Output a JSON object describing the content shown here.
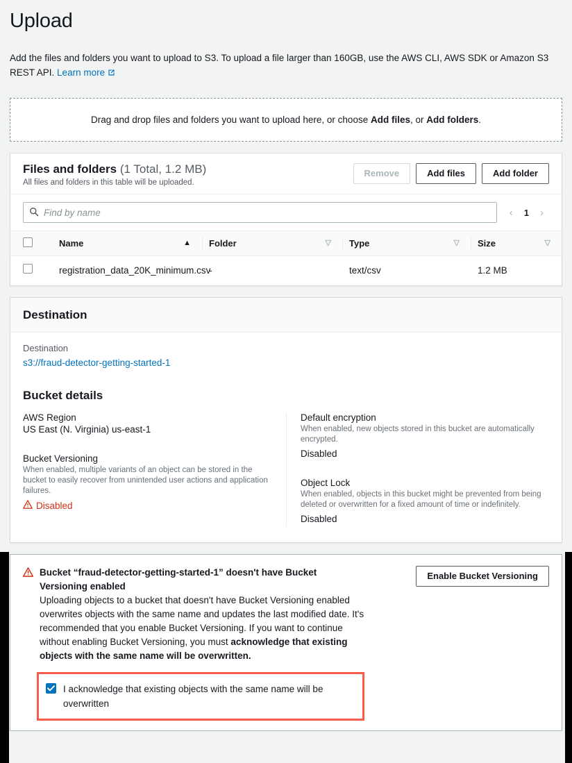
{
  "header": {
    "title": "Upload",
    "description_part1": "Add the files and folders you want to upload to S3. To upload a file larger than 160GB, use the AWS CLI, AWS SDK or Amazon S3 REST API.",
    "learn_more": "Learn more",
    "external_link_icon": "external-link-icon"
  },
  "dropzone": {
    "text_before": "Drag and drop files and folders you want to upload here, or choose ",
    "add_files_bold": "Add files",
    "text_middle": ", or ",
    "add_folders_bold": "Add folders",
    "text_after": "."
  },
  "files_panel": {
    "title": "Files and folders",
    "count": "(1 Total, 1.2 MB)",
    "subtitle": "All files and folders in this table will be uploaded.",
    "buttons": {
      "remove": "Remove",
      "add_files": "Add files",
      "add_folder": "Add folder"
    },
    "search": {
      "placeholder": "Find by name",
      "value": "",
      "icon": "search-icon"
    },
    "pagination": {
      "prev": "‹",
      "page": "1",
      "next": "›"
    },
    "columns": [
      {
        "label": "Name",
        "sort": "asc"
      },
      {
        "label": "Folder",
        "sort": "none"
      },
      {
        "label": "Type",
        "sort": "none"
      },
      {
        "label": "Size",
        "sort": "none"
      }
    ],
    "rows": [
      {
        "name": "registration_data_20K_minimum.csv",
        "folder": "-",
        "type": "text/csv",
        "size": "1.2 MB",
        "selected": false
      }
    ]
  },
  "destination": {
    "section_title": "Destination",
    "label": "Destination",
    "path": "s3://fraud-detector-getting-started-1",
    "bucket_details_title": "Bucket details",
    "fields": [
      {
        "title": "AWS Region",
        "desc": "",
        "value": "US East (N. Virginia) us-east-1",
        "warn": false
      },
      {
        "title": "Default encryption",
        "desc": "When enabled, new objects stored in this bucket are automatically encrypted.",
        "value": "Disabled",
        "warn": false
      },
      {
        "title": "Bucket Versioning",
        "desc": "When enabled, multiple variants of an object can be stored in the bucket to easily recover from unintended user actions and application failures.",
        "value": "Disabled",
        "warn": true
      },
      {
        "title": "Object Lock",
        "desc": "When enabled, objects in this bucket might be prevented from being deleted or overwritten for a fixed amount of time or indefinitely.",
        "value": "Disabled",
        "warn": false
      }
    ]
  },
  "alert": {
    "icon": "warning-triangle-icon",
    "title": "Bucket “fraud-detector-getting-started-1” doesn't have Bucket Versioning enabled",
    "body_part1": "Uploading objects to a bucket that doesn't have Bucket Versioning enabled overwrites objects with the same name and updates the last modified date. It's recommended that you enable Bucket Versioning. If you want to continue without enabling Bucket Versioning, you must ",
    "body_bold": "acknowledge that existing objects with the same name will be overwritten.",
    "button": "Enable Bucket Versioning",
    "acknowledge_label": "I acknowledge that existing objects with the same name will be overwritten",
    "acknowledge_checked": true,
    "highlight_color": "#f95c4b"
  },
  "colors": {
    "link": "#0073bb",
    "warning": "#d13212",
    "checkbox_checked": "#0073bb",
    "highlight": "#f95c4b",
    "page_bg": "#f2f3f3"
  }
}
